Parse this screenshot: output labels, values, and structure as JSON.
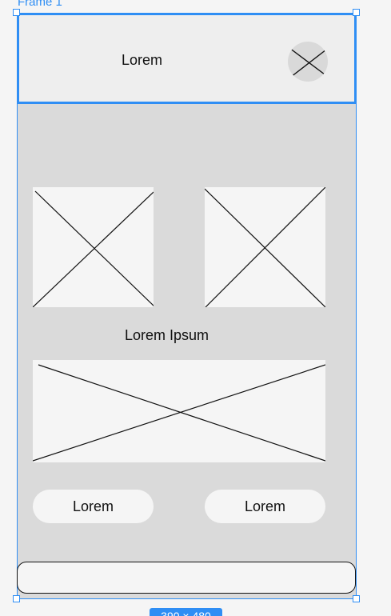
{
  "design_tool": {
    "frame_label": "Frame 1",
    "size_badge": "390 × 480"
  },
  "header": {
    "title": "Lorem",
    "avatar_icon": "placeholder-x-icon"
  },
  "content": {
    "section_title": "Lorem Ipsum",
    "image_placeholders": [
      {
        "name": "image-placeholder-left",
        "icon": "placeholder-x-icon"
      },
      {
        "name": "image-placeholder-right",
        "icon": "placeholder-x-icon"
      },
      {
        "name": "image-placeholder-wide",
        "icon": "placeholder-x-icon"
      }
    ],
    "buttons": [
      {
        "label": "Lorem"
      },
      {
        "label": "Lorem"
      }
    ]
  },
  "colors": {
    "selection_blue": "#2f8ef4",
    "frame_gray": "#dadada",
    "placeholder_light": "#f5f5f5",
    "header_gray": "#eeeeee",
    "avatar_gray": "#d9d9d9",
    "text": "#111111"
  }
}
